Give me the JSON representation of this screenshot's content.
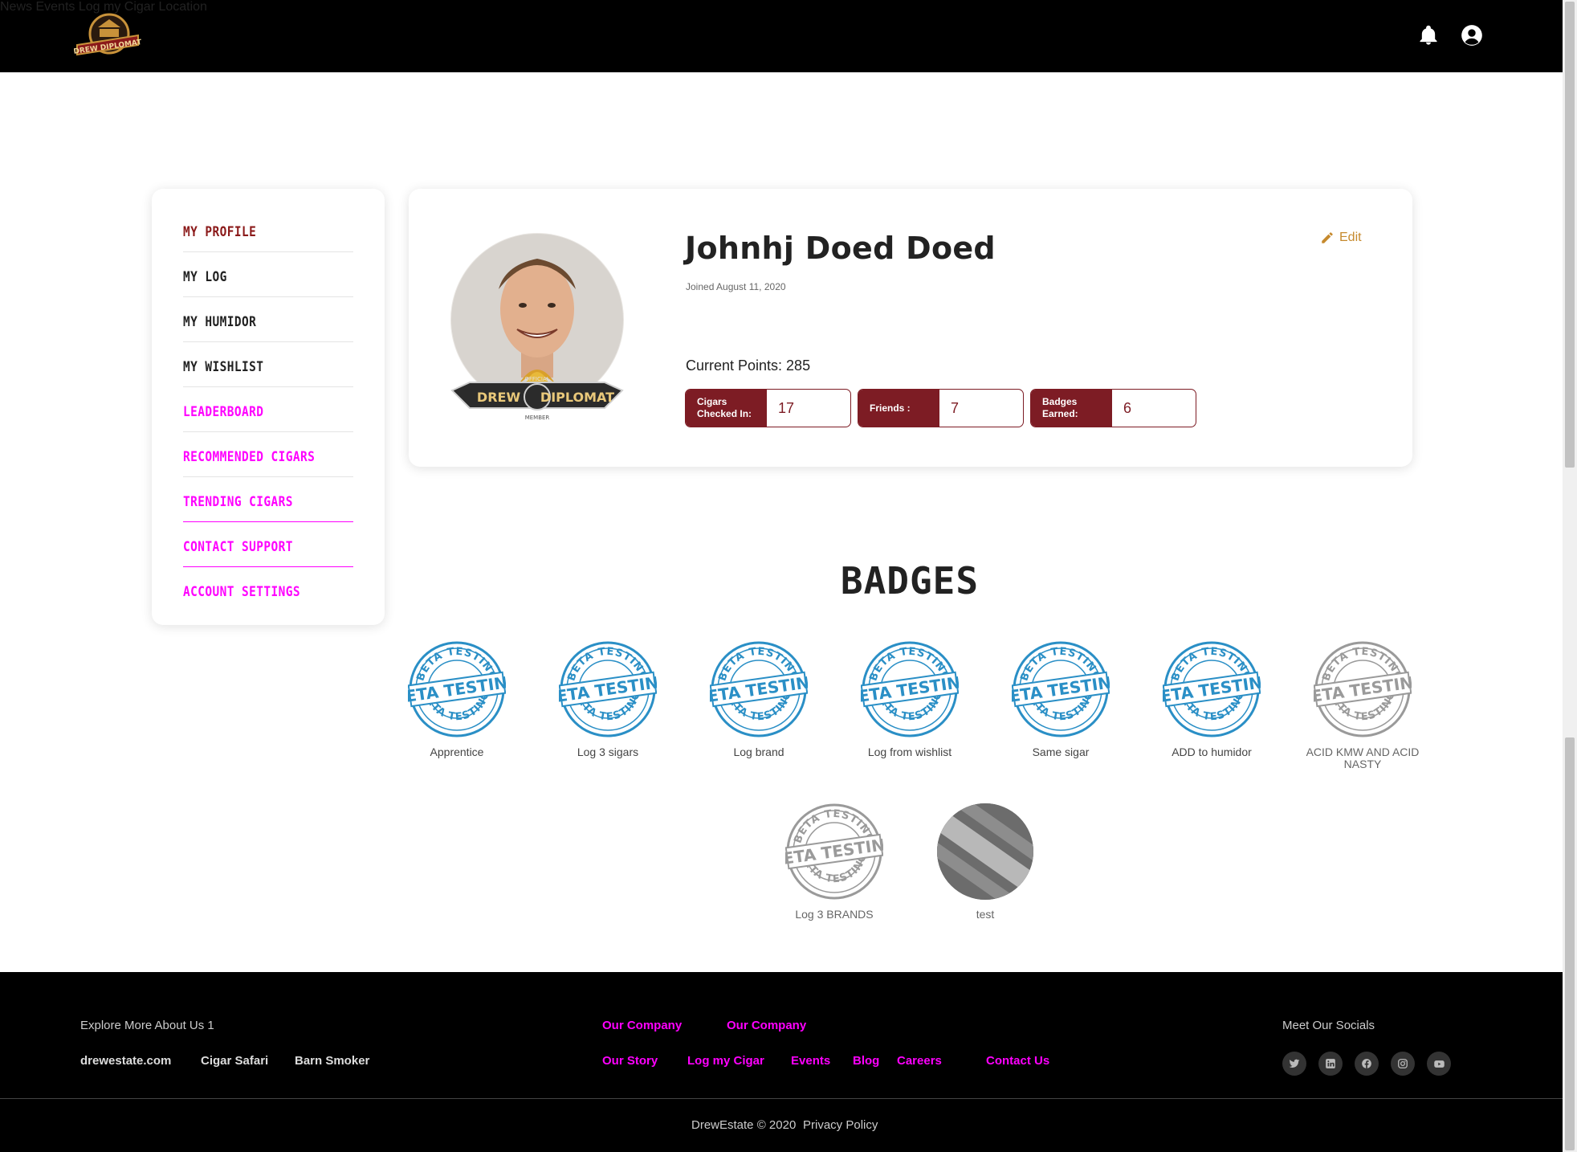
{
  "header": {
    "logo_text": "DREW DIPLOMAT",
    "nav": [
      "News",
      "Events",
      "Log my Cigar",
      "Location"
    ]
  },
  "sidebar": {
    "items": [
      {
        "label": "My Profile",
        "state": "active"
      },
      {
        "label": "My Log",
        "state": "normal"
      },
      {
        "label": "My Humidor",
        "state": "normal"
      },
      {
        "label": "My Wishlist",
        "state": "normal"
      },
      {
        "label": "Leaderboard",
        "state": "magenta"
      },
      {
        "label": "Recommended Cigars",
        "state": "magenta"
      },
      {
        "label": "Trending Cigars",
        "state": "magenta"
      },
      {
        "label": "Contact Support",
        "state": "magenta"
      },
      {
        "label": "Account Settings",
        "state": "magenta"
      }
    ]
  },
  "profile": {
    "name": "Johnhj Doed Doed",
    "joined": "Joined August 11, 2020",
    "edit_label": "Edit",
    "points_label": "Current Points: 285",
    "stats": [
      {
        "label_line1": "Cigars",
        "label_line2": "Checked In:",
        "value": "17"
      },
      {
        "label_line1": "Friends :",
        "label_line2": "",
        "value": "7"
      },
      {
        "label_line1": "Badges",
        "label_line2": "Earned:",
        "value": "6"
      }
    ]
  },
  "badges": {
    "title": "BADGES",
    "items": [
      {
        "label": "Apprentice",
        "earned": true
      },
      {
        "label": "Log 3 sigars",
        "earned": true
      },
      {
        "label": "Log brand",
        "earned": true
      },
      {
        "label": "Log from wishlist",
        "earned": true
      },
      {
        "label": "Same sigar",
        "earned": true
      },
      {
        "label": "ADD to humidor",
        "earned": true
      },
      {
        "label": "ACID KMW AND ACID NASTY",
        "earned": false
      },
      {
        "label": "Log 3 BRANDS",
        "earned": false
      },
      {
        "label": "test",
        "earned": false
      }
    ],
    "stamp_text": "BETA TESTING"
  },
  "footer": {
    "explore_title": "Explore More About Us 1",
    "explore_links": [
      "drewestate.com",
      "Cigar Safari",
      "Barn Smoker"
    ],
    "company_headers": [
      "Our Company",
      "Our Company"
    ],
    "company_links": [
      "Our Story",
      "Log my Cigar",
      "Events",
      "Blog",
      "Careers",
      "Contact Us"
    ],
    "socials_title": "Meet Our Socials",
    "socials": [
      "twitter-icon",
      "linkedin-icon",
      "facebook-icon",
      "instagram-icon",
      "youtube-icon"
    ],
    "copyright": "DrewEstate © 2020",
    "privacy": "Privacy Policy"
  },
  "colors": {
    "accent": "#7d1c24",
    "magenta": "#ff00ff",
    "edit": "#c68a2e",
    "badge_blue": "#2a8fc6"
  }
}
